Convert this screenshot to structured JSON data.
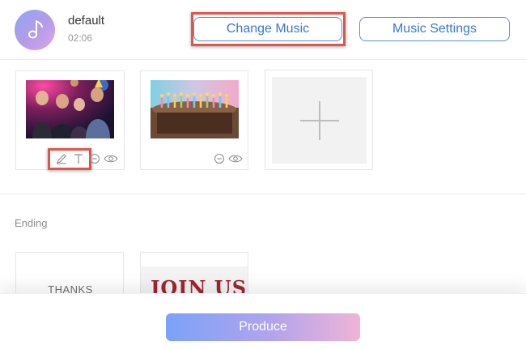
{
  "music": {
    "name": "default",
    "duration": "02:06",
    "change_label": "Change Music",
    "settings_label": "Music Settings"
  },
  "ending": {
    "label": "Ending",
    "thanks_text": "THANKS",
    "join_text": "JOIN US"
  },
  "footer": {
    "produce_label": "Produce"
  },
  "colors": {
    "accent": "#3a78d0",
    "highlight": "#de5647"
  }
}
